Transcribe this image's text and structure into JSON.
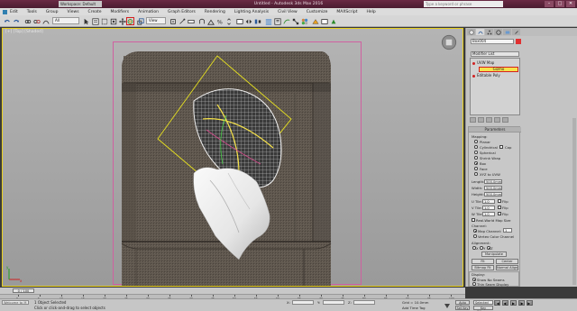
{
  "window": {
    "title": "Untitled - Autodesk 3ds Max 2016",
    "workspace": "Workspace: Default",
    "search_placeholder": "Type a keyword or phrase",
    "controls": [
      "–",
      "□",
      "✕"
    ]
  },
  "menubar": {
    "items": [
      "Edit",
      "Tools",
      "Group",
      "Views",
      "Create",
      "Modifiers",
      "Animation",
      "Graph Editors",
      "Rendering",
      "Lighting Analysis",
      "Civil View",
      "Customize",
      "MAXScript",
      "Help"
    ]
  },
  "toolbar": {
    "selection_filter": "All",
    "reference_coord": "View",
    "highlighted_tool": "select-and-rotate"
  },
  "viewport": {
    "label": "[+] [Top] [Shaded]"
  },
  "command_panel": {
    "object_name": "Box004",
    "modifier_list": "Modifier List",
    "stack": [
      {
        "label": "UVW Map"
      },
      {
        "label": "Gizmo"
      },
      {
        "label": "Editable Poly"
      }
    ],
    "parameters_title": "Parameters",
    "mapping_label": "Mapping:",
    "mapping_options": [
      "Planar",
      "Cylindrical",
      "Spherical",
      "Shrink Wrap",
      "Box",
      "Face",
      "XYZ to UVW"
    ],
    "mapping_selected": "Box",
    "cap_label": "Cap",
    "length_label": "Length:",
    "length_value": "500.0mm",
    "width_label": "Width:",
    "width_value": "500.0mm",
    "height_label": "Height:",
    "height_value": "500.0mm",
    "u_tile_label": "U Tile:",
    "u_tile_value": "1.0",
    "v_tile_label": "V Tile:",
    "v_tile_value": "1.0",
    "w_tile_label": "W Tile:",
    "w_tile_value": "1.0",
    "flip_label": "Flip",
    "real_world_label": "Real-World Map Size",
    "channel_label": "Channel:",
    "map_channel_label": "Map Channel:",
    "map_channel_value": "1",
    "vertex_color_label": "Vertex Color Channel",
    "alignment_label": "Alignment:",
    "align_axes": [
      "X",
      "Y",
      "Z"
    ],
    "align_selected": "Z",
    "manipulate_label": "Manipulate",
    "fit_label": "Fit",
    "center_label": "Center",
    "bitmap_fit_label": "Bitmap Fit",
    "normal_align_label": "Normal Align",
    "view_align_label": "View Align",
    "region_fit_label": "Region Fit",
    "reset_label": "Reset",
    "acquire_label": "Acquire",
    "display_label": "Display:",
    "show_no_seams": "Show No Seams",
    "thin_seam_display": "Thin Seam Display"
  },
  "timeline": {
    "frame_display": "0 / 100",
    "ticks": [
      0,
      5,
      10,
      15,
      20,
      25,
      30,
      35,
      40,
      45,
      50,
      55,
      60,
      65,
      70,
      75,
      80,
      85,
      90,
      95,
      100
    ]
  },
  "statusbar": {
    "maxscript": "Welcome to M",
    "objects_selected": "1 Object Selected",
    "prompt": "Click or click-and-drag to select objects",
    "x_label": "X:",
    "y_label": "Y:",
    "z_label": "Z:",
    "grid": "Grid = 10.0mm",
    "add_time_tag": "Add Time Tag",
    "auto_key": "Auto Key",
    "set_key": "Set Key",
    "selected": "Selected",
    "key_filters": "Key Filters...",
    "playback": [
      "|◀",
      "◀|",
      "▶",
      "|▶",
      "▶|"
    ]
  },
  "colors": {
    "accent_red": "#d42020",
    "title_bg": "#5a2238",
    "viewport_border": "#e8d020",
    "safe_frame": "#d060a0",
    "gizmo": "#e6e020",
    "stack_selected": "#f6e24a"
  }
}
